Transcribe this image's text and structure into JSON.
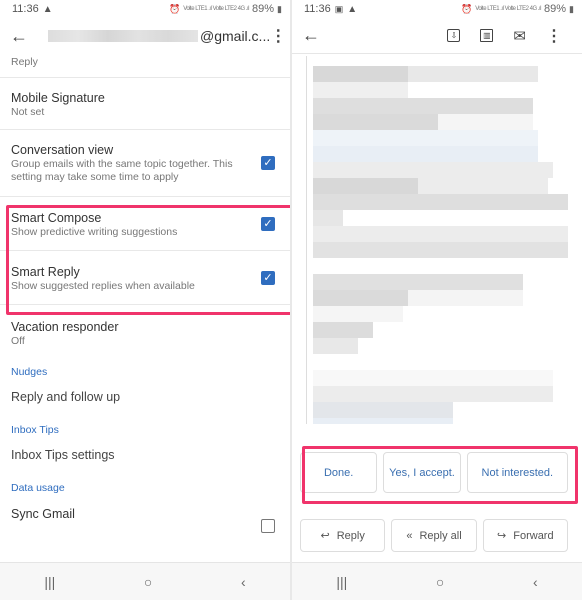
{
  "status_bar": {
    "time": "11:36",
    "battery": "89%",
    "signal_text": "Volte LTE1 .ıl Volte LTE2 4G .ıl"
  },
  "left": {
    "account": "@gmail.c...",
    "partial_item_sub": "Reply",
    "settings": [
      {
        "title": "Mobile Signature",
        "sub": "Not set"
      },
      {
        "title": "Conversation view",
        "sub": "Group emails with the same topic together. This setting may take some time to apply",
        "checked": true
      },
      {
        "title": "Smart Compose",
        "sub": "Show predictive writing suggestions",
        "checked": true
      },
      {
        "title": "Smart Reply",
        "sub": "Show suggested replies when available",
        "checked": true
      },
      {
        "title": "Vacation responder",
        "sub": "Off"
      }
    ],
    "sections": [
      {
        "header": "Nudges",
        "item": "Reply and follow up"
      },
      {
        "header": "Inbox Tips",
        "item": "Inbox Tips settings"
      },
      {
        "header": "Data usage",
        "item": "Sync Gmail"
      }
    ]
  },
  "right": {
    "smart_replies": [
      "Done.",
      "Yes, I accept.",
      "Not interested."
    ],
    "actions": [
      "Reply",
      "Reply all",
      "Forward"
    ]
  },
  "icons": {
    "check": "✓",
    "back": "←",
    "more": "⋮",
    "reply": "↩",
    "reply_all": "«",
    "forward": "↪",
    "nav_recent": "|||",
    "nav_home": "○",
    "nav_back": "‹",
    "archive": "⇩",
    "trash": "▥",
    "mail": "✉"
  },
  "accent_color": "#2f6dbf",
  "highlight_color": "#f0346b"
}
